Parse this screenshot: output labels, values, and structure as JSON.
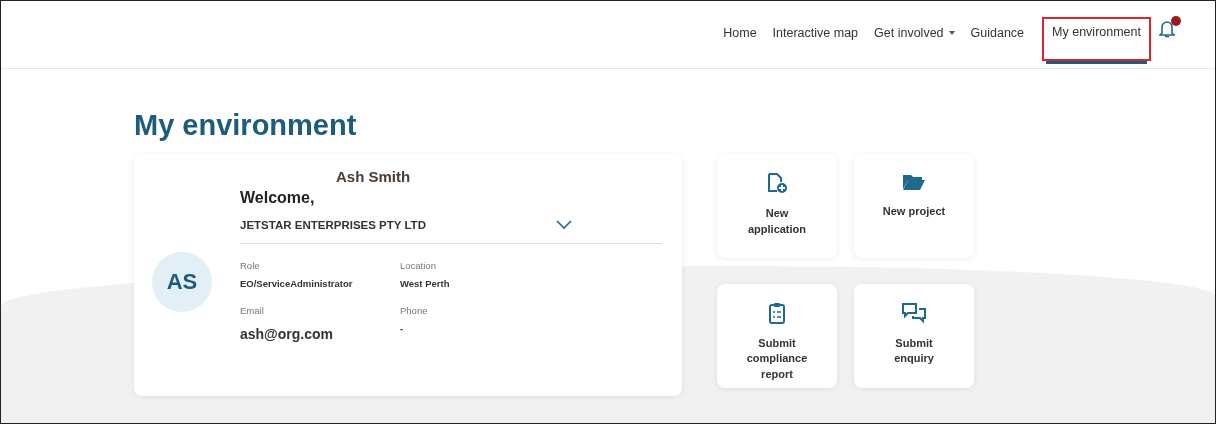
{
  "nav": {
    "items": [
      {
        "label": "Home",
        "selected": false,
        "dropdown": false
      },
      {
        "label": "Interactive map",
        "selected": false,
        "dropdown": false
      },
      {
        "label": "Get involved",
        "selected": false,
        "dropdown": true
      },
      {
        "label": "Guidance",
        "selected": false,
        "dropdown": false
      },
      {
        "label": "My environment",
        "selected": true,
        "dropdown": false
      }
    ],
    "notifications": {
      "unread": true
    }
  },
  "page_title": "My environment",
  "profile": {
    "name": "Ash Smith",
    "greeting": "Welcome,",
    "initials": "AS",
    "organisation": "JETSTAR ENTERPRISES PTY LTD",
    "fields": [
      {
        "label": "Role",
        "value": "EO/ServiceAdministrator"
      },
      {
        "label": "Location",
        "value": "West Perth"
      },
      {
        "label": "Email",
        "value": "ash@org.com"
      },
      {
        "label": "Phone",
        "value": "-"
      }
    ]
  },
  "actions": [
    {
      "kind": "new-file",
      "label": "New application"
    },
    {
      "kind": "folder",
      "label": "New project"
    },
    {
      "kind": "clipboard",
      "label": "Submit compliance report"
    },
    {
      "kind": "chat",
      "label": "Submit enquiry"
    }
  ]
}
